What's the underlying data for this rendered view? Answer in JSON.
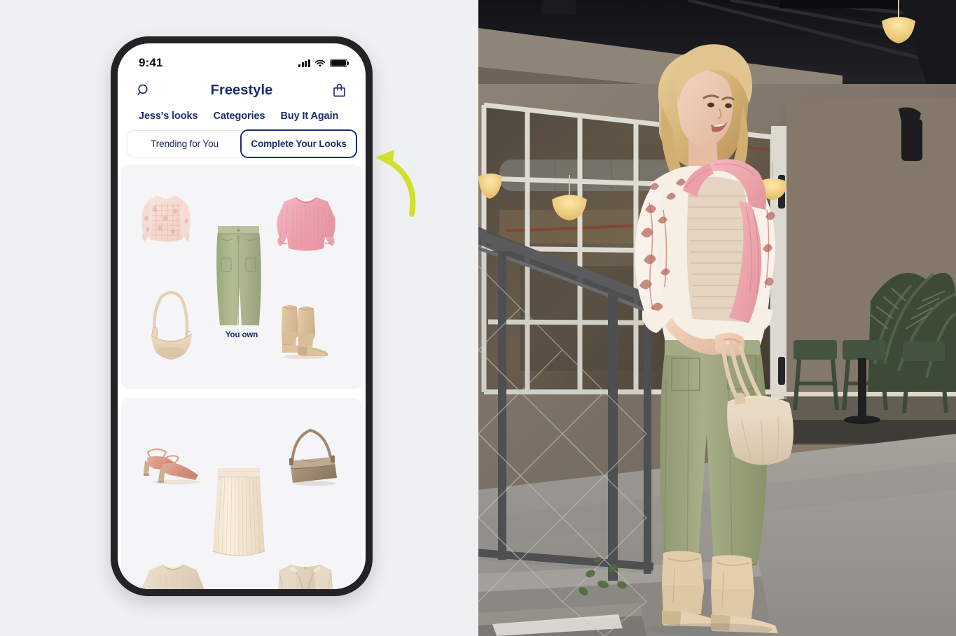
{
  "theme": {
    "brand_navy": "#1b2e6b",
    "background_gray": "#eff0f2",
    "card_gray": "#f5f5f7",
    "arrow_green": "#cfe02e",
    "phone_frame": "#232325"
  },
  "phone": {
    "status_bar": {
      "time": "9:41",
      "signal_icon": "cellular-signal-icon",
      "wifi_icon": "wifi-icon",
      "battery_icon": "battery-full-icon"
    },
    "header": {
      "search_icon": "search-icon",
      "title": "Freestyle",
      "bag_icon": "shopping-bag-icon"
    },
    "nav_tabs": [
      {
        "label": "Jess's looks",
        "active": true
      },
      {
        "label": "Categories",
        "active": false
      },
      {
        "label": "Buy It Again",
        "active": false
      }
    ],
    "segmented_control": [
      {
        "label": "Trending for You",
        "selected": false
      },
      {
        "label": "Complete Your Looks",
        "selected": true
      }
    ],
    "outfit_cards": [
      {
        "owned_label": "You own",
        "items": [
          {
            "name": "pink-floral-smocked-top",
            "color": "#f2d3cb"
          },
          {
            "name": "olive-cargo-pants",
            "color": "#a8b184"
          },
          {
            "name": "pink-ribbed-sweater",
            "color": "#eda9b4"
          },
          {
            "name": "tan-crescent-shoulder-bag",
            "color": "#e2cfb7"
          },
          {
            "name": "tan-ankle-boots",
            "color": "#d7bd9b"
          }
        ]
      },
      {
        "owned_label": "",
        "items": [
          {
            "name": "pink-snakeskin-slingback-heels",
            "color": "#dba898"
          },
          {
            "name": "cream-pleated-midi-skirt",
            "color": "#f2e3d2"
          },
          {
            "name": "taupe-flap-shoulder-bag",
            "color": "#ab9780"
          },
          {
            "name": "cream-knit-sweater",
            "color": "#e5d9c6"
          },
          {
            "name": "cream-sleeveless-vest",
            "color": "#e3d6c2"
          }
        ]
      }
    ]
  },
  "annotation": {
    "arrow_name": "callout-arrow-to-complete-your-looks",
    "color": "#cfe02e"
  },
  "photo": {
    "alt_name": "model-lifestyle-photo",
    "subject": "blonde-woman-standing-on-steps",
    "outfit": {
      "blouse": "pink-floral-print-blouse",
      "cardigan": "pink-draped-cardigan",
      "pants": "olive-green-cargo-pants",
      "bag": "cream-slouchy-shoulder-bag",
      "boots": "tan-ankle-boots"
    },
    "setting": "industrial-cafe-exterior-with-windows-and-pendant-lights"
  }
}
